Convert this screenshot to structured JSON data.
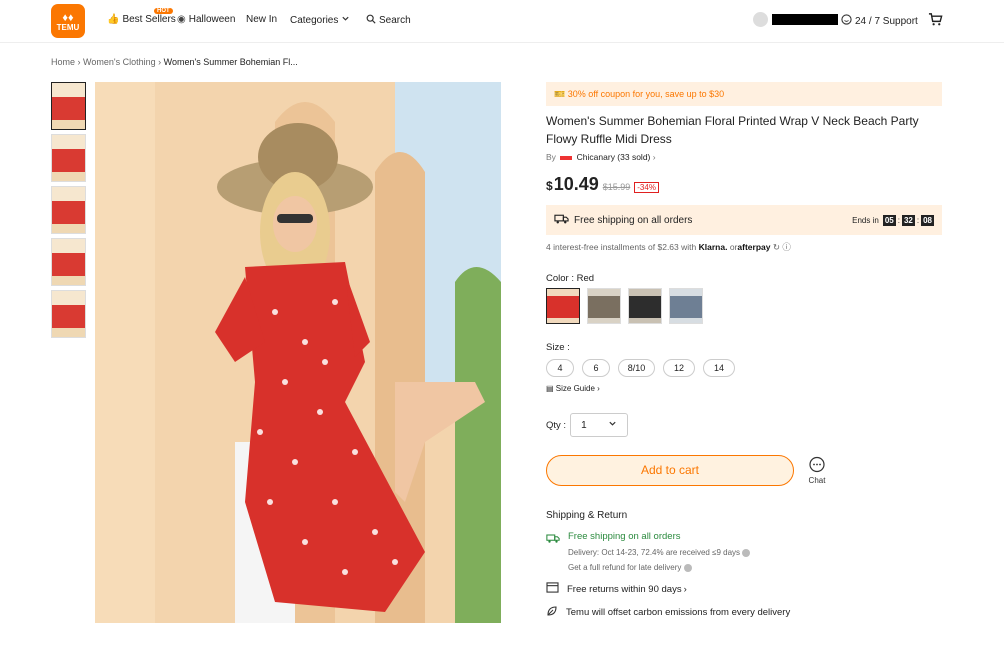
{
  "header": {
    "logo_text": "TEMU",
    "nav": {
      "best_sellers": "Best Sellers",
      "hot_badge": "HOT",
      "halloween": "Halloween",
      "new_in": "New In",
      "categories": "Categories",
      "search": "Search"
    },
    "support": "24 / 7 Support"
  },
  "breadcrumb": {
    "home": "Home",
    "category": "Women's Clothing",
    "current": "Women's Summer Bohemian Fl..."
  },
  "product": {
    "coupon": "30% off coupon for you, save up to $30",
    "title": "Women's Summer Bohemian Floral Printed Wrap V Neck Beach Party Flowy Ruffle Midi Dress",
    "by": "By",
    "store": "Chicanary (33 sold)",
    "currency": "$",
    "price": "10.49",
    "original_price": "$15.99",
    "discount": "-34%",
    "free_shipping": "Free shipping on all orders",
    "ends_in": "Ends in",
    "timer": [
      "05",
      "32",
      "08"
    ],
    "installments": "4 interest-free installments of $2.63 with",
    "klarna": "Klarna.",
    "or": "or",
    "afterpay": "afterpay",
    "color_label": "Color : Red",
    "colors": [
      "Red",
      "Beige",
      "Black",
      "Blue"
    ],
    "size_label": "Size :",
    "sizes": [
      "4",
      "6",
      "8/10",
      "12",
      "14"
    ],
    "size_guide": "Size Guide",
    "qty_label": "Qty :",
    "qty_value": "1",
    "add_to_cart": "Add to cart",
    "chat": "Chat"
  },
  "shipping": {
    "title": "Shipping & Return",
    "free": "Free shipping on all orders",
    "delivery": "Delivery: Oct 14-23, 72.4% are received ≤9 days",
    "refund": "Get a full refund for late delivery",
    "returns": "Free returns within 90 days",
    "carbon": "Temu will offset carbon emissions from every delivery"
  }
}
